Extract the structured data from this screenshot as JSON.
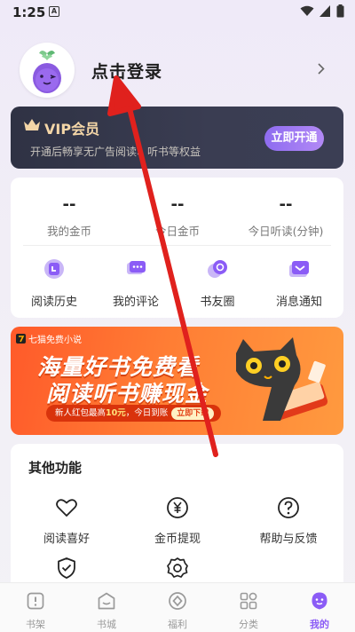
{
  "status_bar": {
    "time": "1:25",
    "notification_glyph": "A"
  },
  "profile": {
    "login_text": "点击登录",
    "avatar_icon": "eggplant-avatar-icon"
  },
  "vip": {
    "title": "VIP会员",
    "subtitle": "开通后畅享无广告阅读、听书等权益",
    "button": "立即开通",
    "accent": "#f4d6a7"
  },
  "stats": [
    {
      "value": "--",
      "label": "我的金币"
    },
    {
      "value": "--",
      "label": "今日金币"
    },
    {
      "value": "--",
      "label": "今日听读(分钟)"
    }
  ],
  "quick_actions": [
    {
      "label": "阅读历史",
      "icon": "clock-icon"
    },
    {
      "label": "我的评论",
      "icon": "comment-icon"
    },
    {
      "label": "书友圈",
      "icon": "circle-icon"
    },
    {
      "label": "消息通知",
      "icon": "message-icon"
    }
  ],
  "banner": {
    "brand": "七猫免费小说",
    "line1": "海量好书免费看",
    "line2": "阅读听书赚现金",
    "promo_prefix": "新人红包最高",
    "promo_amount": "10元",
    "promo_suffix": "，今日到账",
    "promo_button": "立即下载"
  },
  "others": {
    "title": "其他功能",
    "items": [
      {
        "label": "阅读喜好",
        "icon": "heart-icon"
      },
      {
        "label": "金币提现",
        "icon": "yen-icon"
      },
      {
        "label": "帮助与反馈",
        "icon": "help-icon"
      },
      {
        "label": "",
        "icon": "shield-check-icon"
      },
      {
        "label": "",
        "icon": "settings-icon"
      }
    ]
  },
  "bottom_nav": [
    {
      "label": "书架",
      "icon": "bookshelf-icon",
      "active": false
    },
    {
      "label": "书城",
      "icon": "bookstore-icon",
      "active": false
    },
    {
      "label": "福利",
      "icon": "welfare-icon",
      "active": false
    },
    {
      "label": "分类",
      "icon": "category-icon",
      "active": false
    },
    {
      "label": "我的",
      "icon": "mine-icon",
      "active": true
    }
  ],
  "colors": {
    "brand_purple": "#8b5cf6",
    "annotation_red": "#e0211d"
  }
}
